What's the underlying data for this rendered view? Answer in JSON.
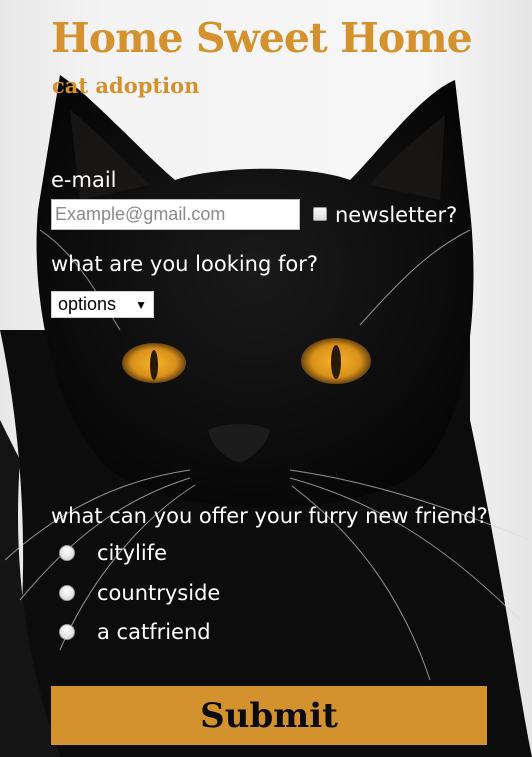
{
  "header": {
    "title": "Home Sweet Home",
    "subtitle": "cat adoption"
  },
  "form": {
    "email_label": "e-mail",
    "email_placeholder": "Example@gmail.com",
    "newsletter_label": "newsletter?",
    "looking_for_label": "what are you looking for?",
    "looking_for_selected": "options",
    "offer_label": "what can you offer your furry new friend?",
    "offer_options": [
      "citylife",
      "countryside",
      "a catfriend"
    ],
    "submit_label": "Submit"
  },
  "colors": {
    "accent": "#d4922e",
    "text": "#ffffff",
    "submit_text": "#0b0b0b"
  },
  "icons": {
    "select_caret": "caret-down-icon"
  }
}
